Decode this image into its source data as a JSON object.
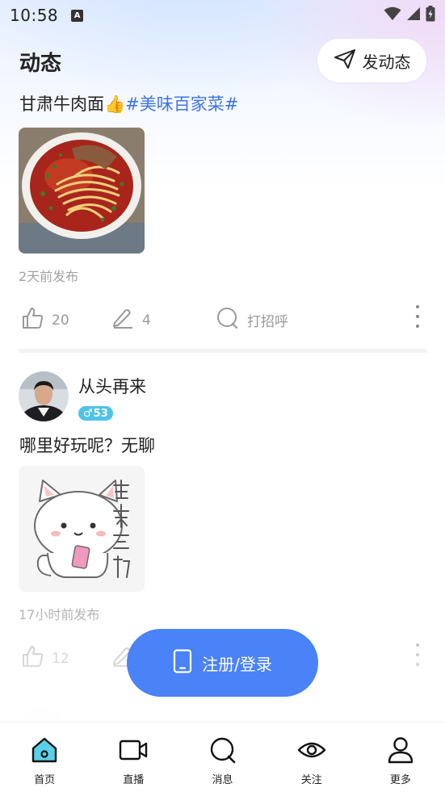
{
  "status_bar": {
    "time": "10:58",
    "icons": [
      "a-icon",
      "wifi-icon",
      "signal-icon",
      "battery-icon"
    ]
  },
  "header": {
    "title": "动态",
    "post_button_label": "发动态",
    "post_button_icon": "send-icon"
  },
  "posts": [
    {
      "text": "甘肃牛肉面",
      "emoji": "👍",
      "hashtag": "#美味百家菜#",
      "image": "beef-noodle-photo",
      "time": "2天前发布",
      "likes": "20",
      "comments": "4",
      "greet_label": "打招呼"
    },
    {
      "username": "从头再来",
      "gender_symbol": "♂",
      "age": "53",
      "text": "哪里好玩呢？无聊",
      "image": "cat-sticker-please-interact",
      "image_text": "请求互动",
      "time": "17小时前发布",
      "likes": "12"
    }
  ],
  "login_button": {
    "label": "注册/登录",
    "icon": "phone-icon"
  },
  "tabs": [
    {
      "label": "首页",
      "icon": "home-icon",
      "active": true
    },
    {
      "label": "直播",
      "icon": "video-icon",
      "active": false
    },
    {
      "label": "消息",
      "icon": "message-icon",
      "active": false
    },
    {
      "label": "关注",
      "icon": "eye-icon",
      "active": false
    },
    {
      "label": "更多",
      "icon": "user-icon",
      "active": false
    }
  ],
  "colors": {
    "accent": "#4a82f7",
    "hashtag": "#3d74e5",
    "badge": "#4fc3e8",
    "active_tab": "#5ad0e8"
  }
}
